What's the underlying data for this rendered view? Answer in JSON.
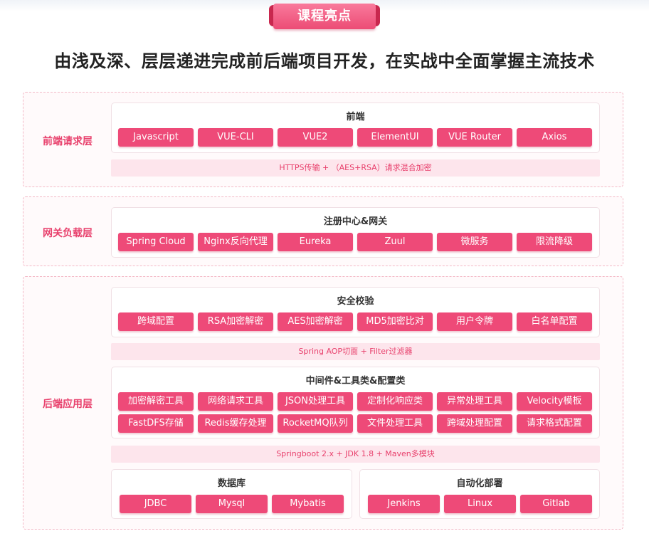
{
  "badge": "课程亮点",
  "title": "由浅及深、层层递进完成前后端项目开发，在实战中全面掌握主流技术",
  "layers": {
    "frontend": {
      "label": "前端请求层",
      "group_title": "前端",
      "chips": [
        "Javascript",
        "VUE-CLI",
        "VUE2",
        "ElementUI",
        "VUE Router",
        "Axios"
      ],
      "note": "HTTPS传输 + （AES+RSA）请求混合加密"
    },
    "gateway": {
      "label": "网关负载层",
      "group_title": "注册中心&网关",
      "chips": [
        "Spring Cloud",
        "Nginx反向代理",
        "Eureka",
        "Zuul",
        "微服务",
        "限流降级"
      ]
    },
    "backend": {
      "label": "后端应用层",
      "security_title": "安全校验",
      "security_chips": [
        "跨域配置",
        "RSA加密解密",
        "AES加密解密",
        "MD5加密比对",
        "用户令牌",
        "白名单配置"
      ],
      "security_note": "Spring AOP切面 + Filter过滤器",
      "middleware_title": "中间件&工具类&配置类",
      "middleware_row1": [
        "加密解密工具",
        "网络请求工具",
        "JSON处理工具",
        "定制化响应类",
        "异常处理工具",
        "Velocity模板"
      ],
      "middleware_row2": [
        "FastDFS存储",
        "Redis缓存处理",
        "RocketMQ队列",
        "文件处理工具",
        "跨域处理配置",
        "请求格式配置"
      ],
      "middleware_note": "Springboot 2.x + JDK 1.8 + Maven多模块",
      "database_title": "数据库",
      "database_chips": [
        "JDBC",
        "Mysql",
        "Mybatis"
      ],
      "deploy_title": "自动化部署",
      "deploy_chips": [
        "Jenkins",
        "Linux",
        "Gitlab"
      ]
    }
  }
}
